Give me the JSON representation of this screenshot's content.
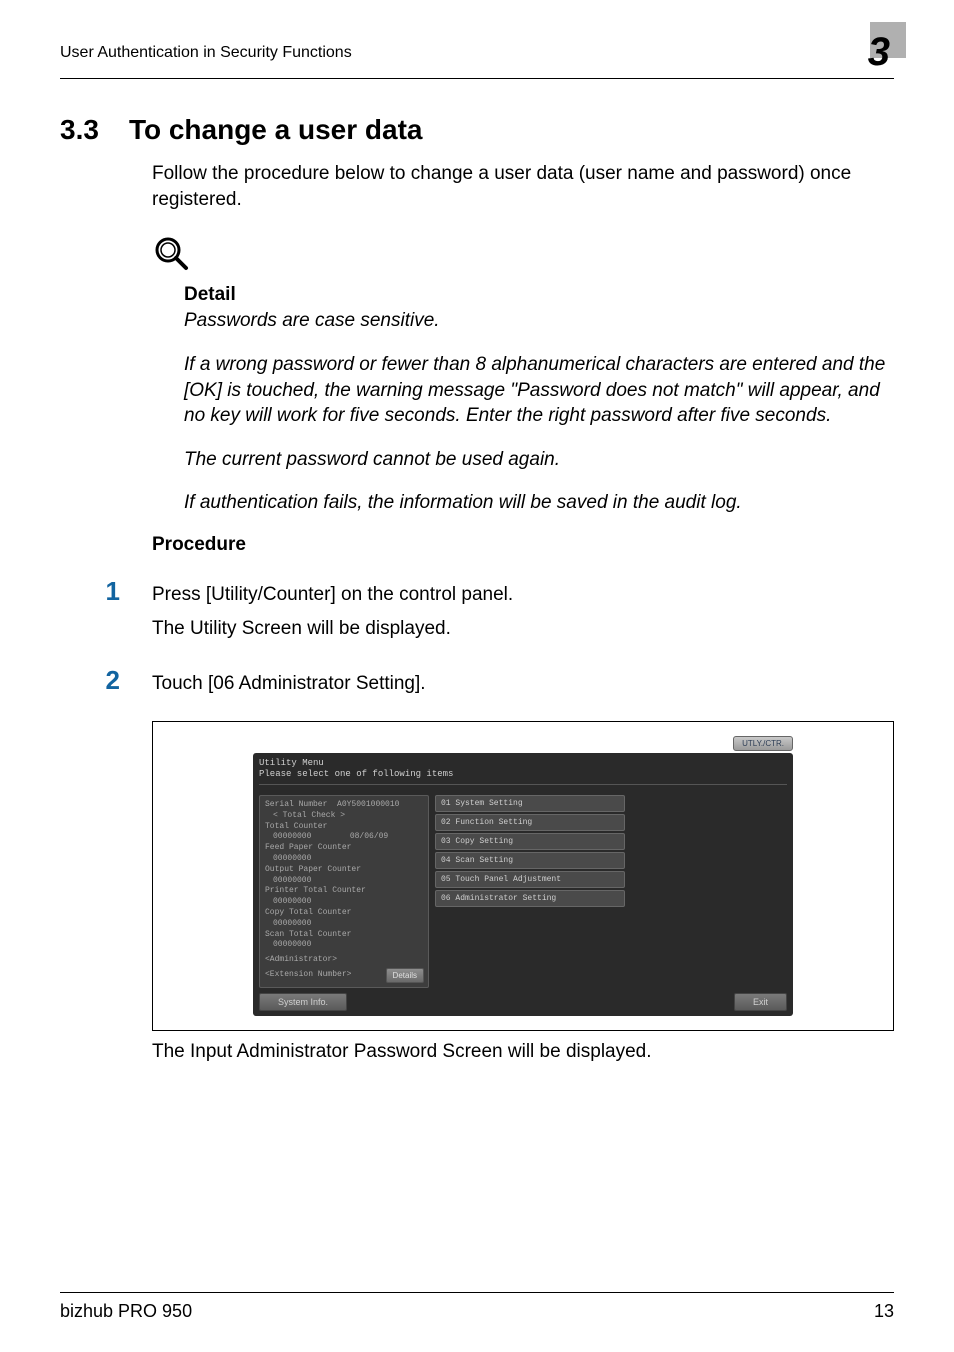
{
  "header": {
    "title": "User Authentication in Security Functions",
    "chapter_number": "3"
  },
  "section": {
    "number": "3.3",
    "title": "To change a user data"
  },
  "intro": "Follow the procedure below to change a user data (user name and password) once registered.",
  "detail": {
    "heading": "Detail",
    "line1": "Passwords are case sensitive.",
    "line2": "If a wrong password or fewer than 8 alphanumerical characters are entered and the [OK] is touched, the warning message \"Password does not match\" will appear, and no key will work for five seconds. Enter the right password after five seconds.",
    "line3": "The current password cannot be used again.",
    "line4": "If authentication fails, the information will be saved in the audit log."
  },
  "procedure_heading": "Procedure",
  "steps": [
    {
      "number": "1",
      "text": "Press [Utility/Counter] on the control panel.",
      "sub": "The Utility Screen will be displayed."
    },
    {
      "number": "2",
      "text": "Touch [06 Administrator Setting].",
      "sub": ""
    }
  ],
  "screenshot": {
    "top_button": "UTLY./CTR.",
    "header_line1": "Utility Menu",
    "header_line2": "Please select one of following items",
    "left_panel": {
      "serial_label": "Serial Number",
      "serial_value": "A0Y5001000010",
      "total_check": "< Total Check >",
      "total_counter_label": "Total Counter",
      "total_counter_value": "00000000",
      "date": "08/06/09",
      "feed_label": "Feed Paper Counter",
      "feed_value": "00000000",
      "output_label": "Output Paper Counter",
      "output_value": "00000000",
      "printer_label": "Printer Total Counter",
      "printer_value": "00000000",
      "copy_label": "Copy Total Counter",
      "copy_value": "00000000",
      "scan_label": "Scan Total Counter",
      "scan_value": "00000000",
      "admin": "<Administrator>",
      "ext": "<Extension Number>",
      "details_btn": "Details"
    },
    "menu": [
      "01 System Setting",
      "02 Function Setting",
      "03 Copy Setting",
      "04 Scan Setting",
      "05 Touch Panel Adjustment",
      "06 Administrator Setting"
    ],
    "bottom": {
      "system_info": "System Info.",
      "exit": "Exit"
    }
  },
  "after_screenshot": "The Input Administrator Password Screen will be displayed.",
  "footer": {
    "product": "bizhub PRO 950",
    "page": "13"
  }
}
